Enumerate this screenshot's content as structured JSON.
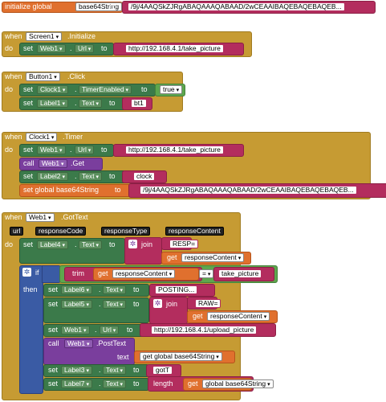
{
  "init": {
    "prefix": "initialize global",
    "name": "base64String",
    "to": "to",
    "value": "/9j/4AAQSkZJRgABAQAAAQABAAD/2wCEAAIBAQEBAQEBAQEB..."
  },
  "screen_init": {
    "when": "when",
    "component": "Screen1",
    "event": ".Initialize",
    "do": "do",
    "set": "set",
    "target": "Web1",
    "dot": ".",
    "prop": "Url",
    "to": "to",
    "value": "http://192.168.4.1/take_picture"
  },
  "button_click": {
    "when": "when",
    "component": "Button1",
    "event": ".Click",
    "do": "do",
    "row1": {
      "set": "set",
      "target": "Clock1",
      "dot": ".",
      "prop": "TimerEnabled",
      "to": "to",
      "value": "true"
    },
    "row2": {
      "set": "set",
      "target": "Label1",
      "dot": ".",
      "prop": "Text",
      "to": "to",
      "value": "bt1"
    }
  },
  "clock_timer": {
    "when": "when",
    "component": "Clock1",
    "event": ".Timer",
    "do": "do",
    "row1": {
      "set": "set",
      "target": "Web1",
      "dot": ".",
      "prop": "Url",
      "to": "to",
      "value": "http://192.168.4.1/take_picture"
    },
    "row2": {
      "call": "call",
      "target": "Web1",
      "method": ".Get"
    },
    "row3": {
      "set": "set",
      "target": "Label2",
      "dot": ".",
      "prop": "Text",
      "to": "to",
      "value": "clock"
    },
    "row4": {
      "set": "set global base64String",
      "to": "to",
      "value": "/9j/4AAQSkZJRgABAQAAAQABAAD/2wCEAAIBAQEBAQEBAQEB..."
    }
  },
  "web_gottext": {
    "when": "when",
    "component": "Web1",
    "event": ".GotText",
    "params": [
      "url",
      "responseCode",
      "responseType",
      "responseContent"
    ],
    "do": "do",
    "label4": {
      "set": "set",
      "target": "Label4",
      "dot": ".",
      "prop": "Text",
      "to": "to",
      "join": "join",
      "part1": "RESP=",
      "get": "get",
      "part2": "responseContent"
    },
    "if_block": {
      "if": "if",
      "then": "then",
      "trim": "trim",
      "get": "get",
      "var": "responseContent",
      "op": "=",
      "compare": "take_picture"
    },
    "label6": {
      "set": "set",
      "target": "Label6",
      "dot": ".",
      "prop": "Text",
      "to": "to",
      "value": "POSTING..."
    },
    "label5": {
      "set": "set",
      "target": "Label5",
      "dot": ".",
      "prop": "Text",
      "to": "to",
      "join": "join",
      "part1": "RAW=",
      "get": "get",
      "part2": "responseContent"
    },
    "web_url": {
      "set": "set",
      "target": "Web1",
      "dot": ".",
      "prop": "Url",
      "to": "to",
      "value": "http://192.168.4.1/upload_picture"
    },
    "post": {
      "call": "call",
      "target": "Web1",
      "method": ".PostText",
      "text": "text",
      "get": "get global base64String"
    },
    "label3": {
      "set": "set",
      "target": "Label3",
      "dot": ".",
      "prop": "Text",
      "to": "to",
      "value": "gotT"
    },
    "label7": {
      "set": "set",
      "target": "Label7",
      "dot": ".",
      "prop": "Text",
      "to": "to",
      "length": "length",
      "get": "get",
      "var": "global base64String"
    }
  }
}
